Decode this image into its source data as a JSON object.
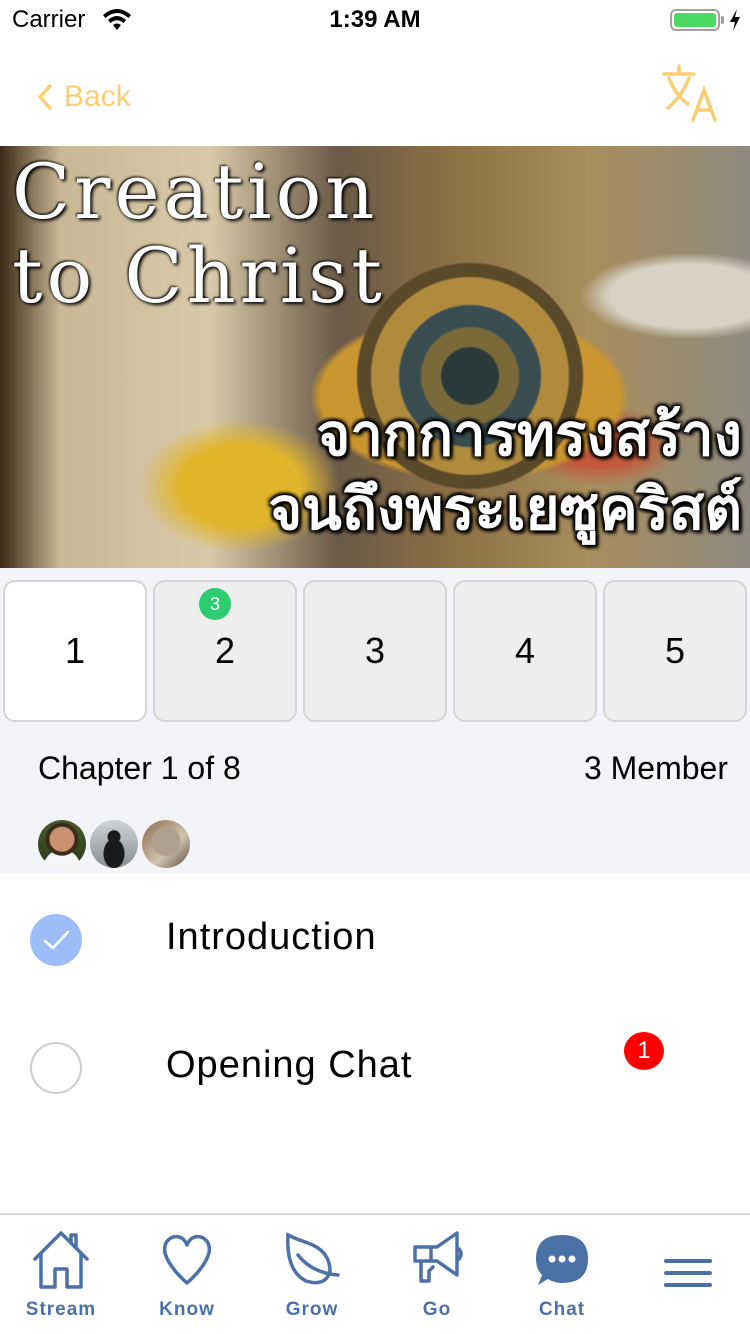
{
  "status_bar": {
    "carrier": "Carrier",
    "time": "1:39 AM",
    "battery_level": 1.0,
    "charging": true
  },
  "nav": {
    "back_label": "Back",
    "back_icon": "chevron-left-icon",
    "translate_icon": "translate-icon",
    "accent_color": "#f9cf72"
  },
  "banner": {
    "title_en_line1": "Creation",
    "title_en_line2": "to Christ",
    "title_th_line1": "จากการทรงสร้าง",
    "title_th_line2": "จนถึงพระเยซูคริสต์"
  },
  "chapter_tabs": [
    {
      "label": "1",
      "active": true,
      "badge": null
    },
    {
      "label": "2",
      "active": false,
      "badge": "3"
    },
    {
      "label": "3",
      "active": false,
      "badge": null
    },
    {
      "label": "4",
      "active": false,
      "badge": null
    },
    {
      "label": "5",
      "active": false,
      "badge": null
    }
  ],
  "chapter_info": {
    "chapter_label": "Chapter 1 of 8",
    "member_count": "3 Member",
    "avatars": [
      "member-1",
      "member-2",
      "member-3"
    ]
  },
  "lessons": [
    {
      "title": "Introduction",
      "completed": true,
      "badge": null
    },
    {
      "title": "Opening Chat",
      "completed": false,
      "badge": "1"
    }
  ],
  "tab_bar": {
    "color": "#4c71a6",
    "items": [
      {
        "label": "Stream",
        "icon": "home-icon"
      },
      {
        "label": "Know",
        "icon": "heart-icon"
      },
      {
        "label": "Grow",
        "icon": "leaf-icon"
      },
      {
        "label": "Go",
        "icon": "megaphone-icon"
      },
      {
        "label": "Chat",
        "icon": "chat-bubble-icon"
      },
      {
        "label": "",
        "icon": "menu-icon"
      }
    ]
  }
}
